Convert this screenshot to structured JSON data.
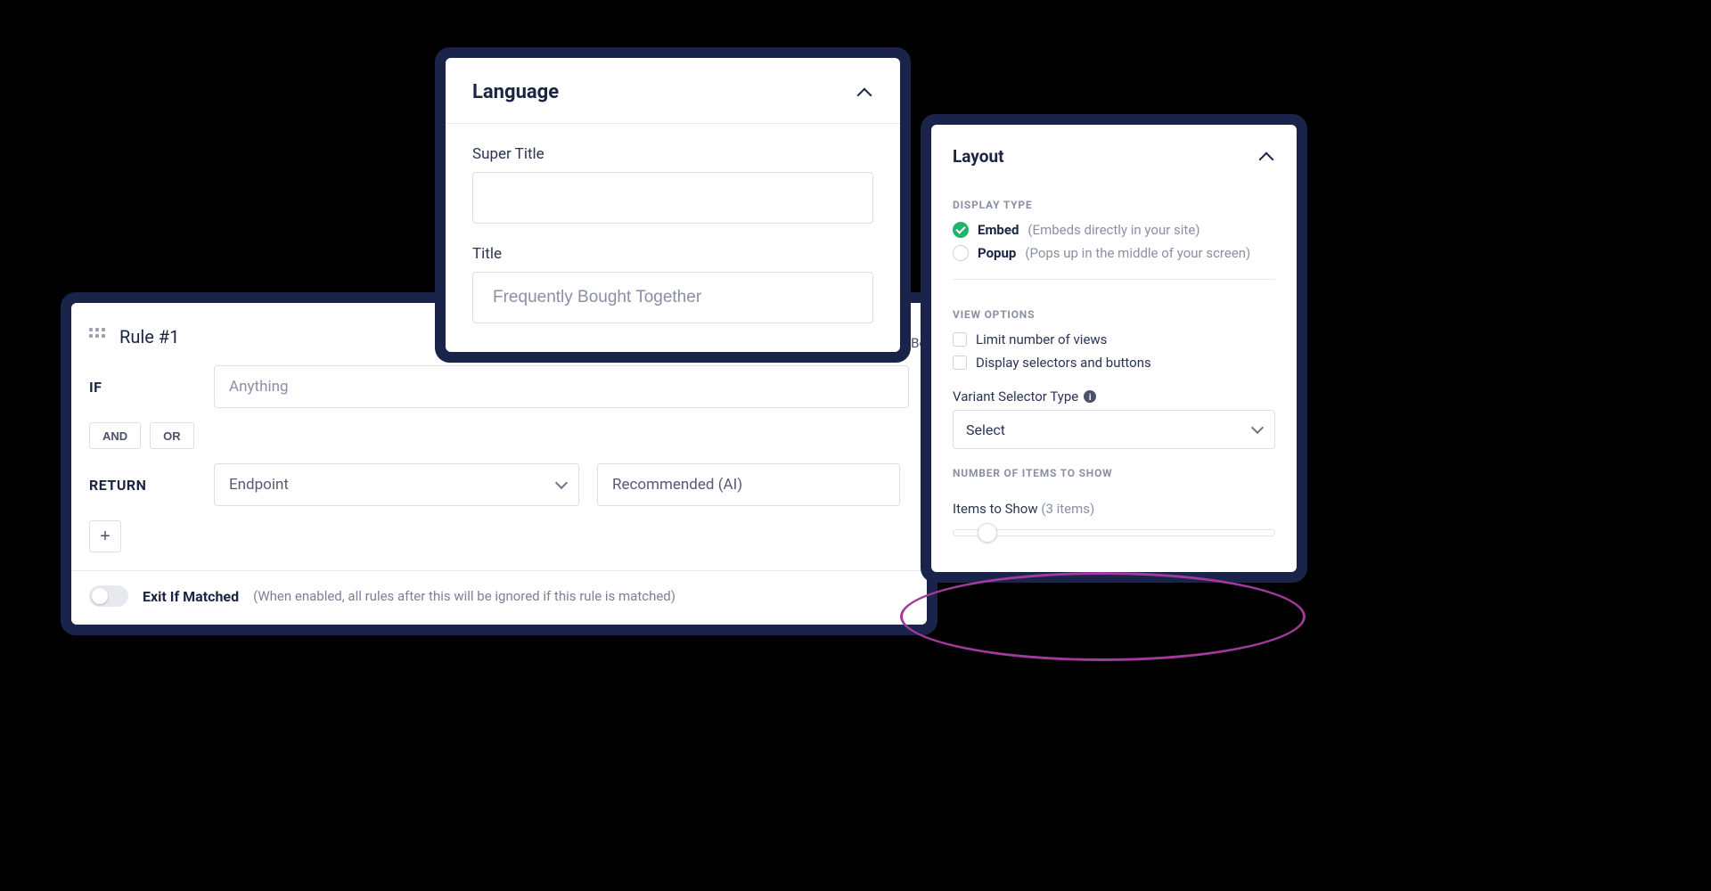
{
  "language": {
    "section_title": "Language",
    "super_title_label": "Super Title",
    "super_title_value": "",
    "title_label": "Title",
    "title_placeholder": "Frequently Bought Together"
  },
  "rule": {
    "header": "Rule #1",
    "if_label": "IF",
    "if_value": "Anything",
    "and_label": "AND",
    "or_label": "OR",
    "return_label": "RETURN",
    "return_source": "Endpoint",
    "return_strategy": "Recommended (AI)",
    "exit_label": "Exit If Matched",
    "exit_desc": "(When enabled, all rules after this will be ignored if this rule is matched)",
    "peek_text": "d Bef"
  },
  "layout": {
    "section_title": "Layout",
    "display_type_heading": "DISPLAY TYPE",
    "embed_label": "Embed",
    "embed_desc": "(Embeds directly in your site)",
    "popup_label": "Popup",
    "popup_desc": "(Pops up in the middle of your screen)",
    "view_options_heading": "VIEW OPTIONS",
    "limit_views_label": "Limit number of views",
    "display_selectors_label": "Display selectors and buttons",
    "variant_selector_label": "Variant Selector Type",
    "variant_selector_value": "Select",
    "num_items_heading": "NUMBER OF ITEMS TO SHOW",
    "items_to_show_label": "Items to Show",
    "items_to_show_count": "(3 items)"
  }
}
